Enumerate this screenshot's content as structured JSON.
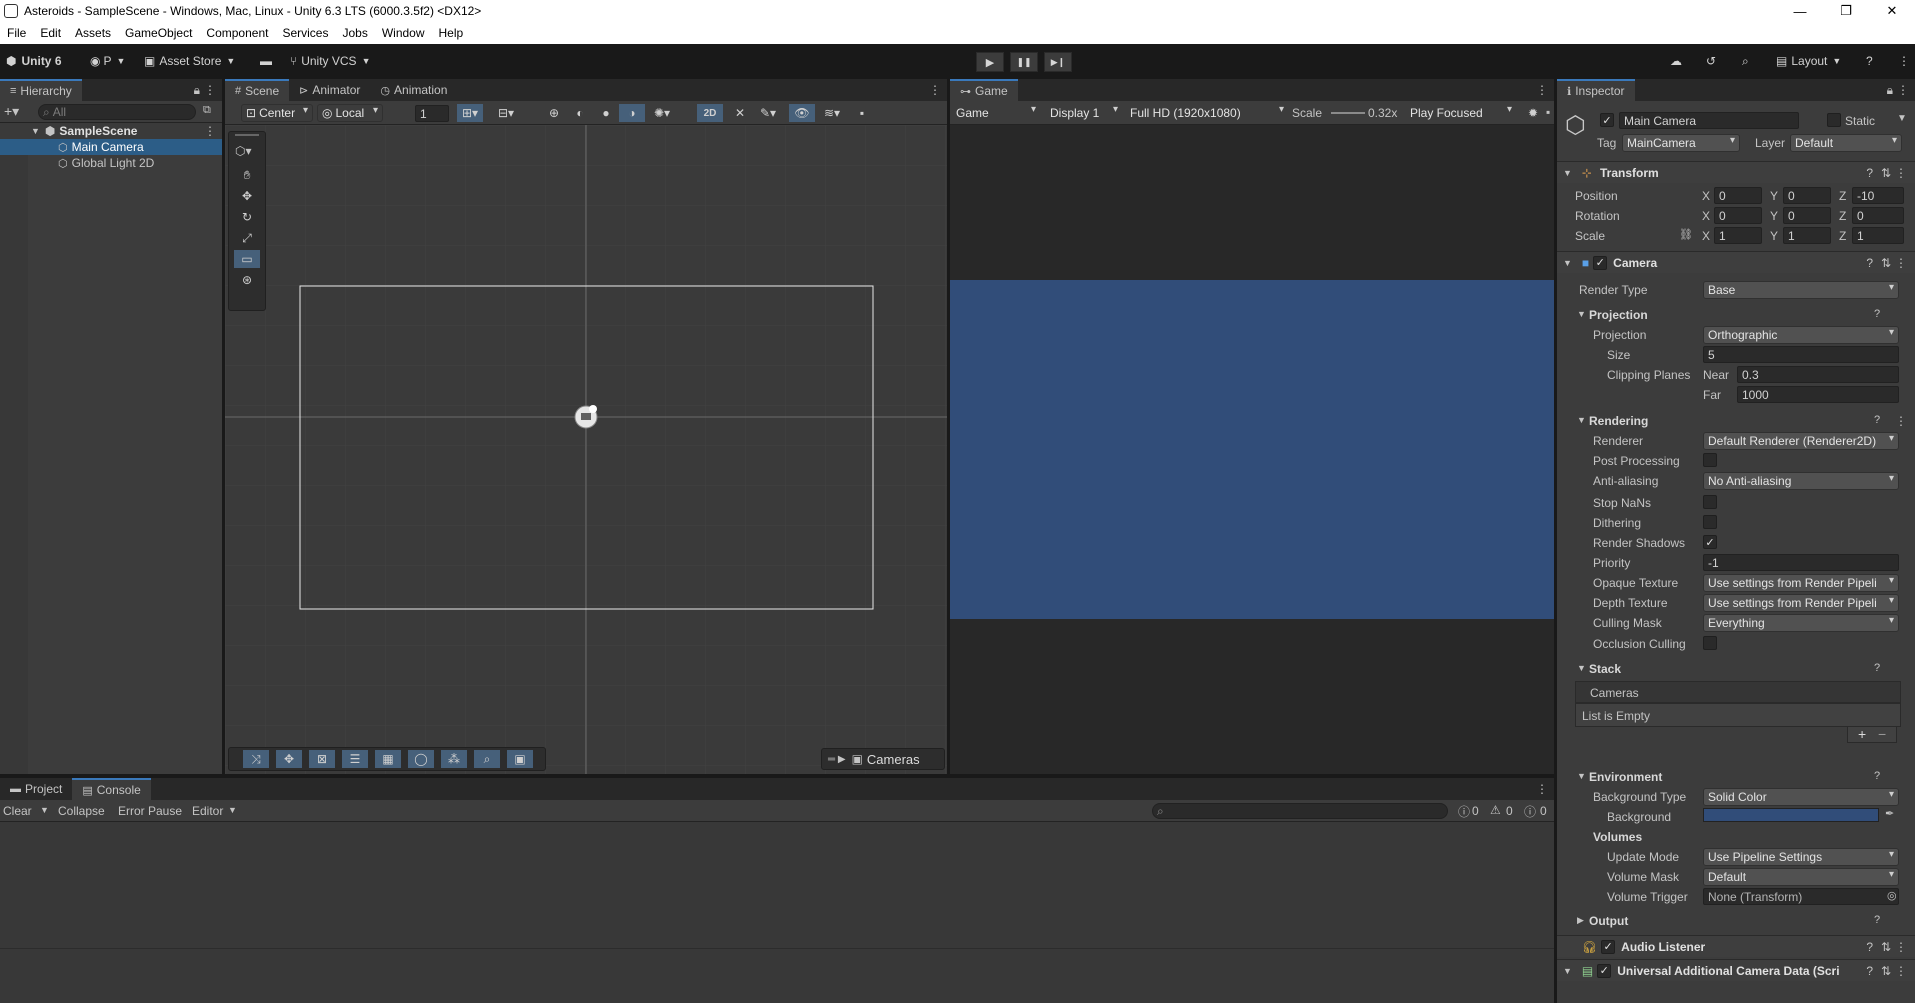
{
  "window": {
    "title": "Asteroids - SampleScene - Windows, Mac, Linux - Unity 6.3 LTS (6000.3.5f2) <DX12>",
    "minimize": "—",
    "maximize": "❐",
    "close": "✕"
  },
  "menu": [
    "File",
    "Edit",
    "Assets",
    "GameObject",
    "Component",
    "Services",
    "Jobs",
    "Window",
    "Help"
  ],
  "toolbar": {
    "unity_label": "Unity 6",
    "account_label": "P",
    "asset_store_label": "Asset Store",
    "vcs_label": "Unity VCS",
    "play": "▶",
    "pause": "❚❚",
    "step": "▶❙",
    "layout_label": "Layout",
    "help": "?"
  },
  "hierarchy": {
    "tab_label": "Hierarchy",
    "search_placeholder": "All",
    "scene_name": "SampleScene",
    "items": [
      {
        "label": "Main Camera"
      },
      {
        "label": "Global Light 2D"
      }
    ]
  },
  "scene_view": {
    "tabs": [
      {
        "label": "Scene",
        "icon": "#"
      },
      {
        "label": "Animator",
        "icon": "⊳"
      },
      {
        "label": "Animation",
        "icon": "◷"
      }
    ],
    "pivot_label": "Center",
    "space_label": "Local",
    "snap_value": "1",
    "mode_2d": "2D",
    "cameras_label": "Cameras"
  },
  "game_view": {
    "tab_label": "Game",
    "mode_label": "Game",
    "display_label": "Display 1",
    "resolution_label": "Full HD (1920x1080)",
    "scale_label": "Scale",
    "scale_value": "0.32x",
    "play_focus_label": "Play Focused",
    "background_color": "#314d79"
  },
  "inspector": {
    "tab_label": "Inspector",
    "object_name": "Main Camera",
    "static_label": "Static",
    "tag_label": "Tag",
    "tag_value": "MainCamera",
    "layer_label": "Layer",
    "layer_value": "Default",
    "transform": {
      "title": "Transform",
      "position_label": "Position",
      "rotation_label": "Rotation",
      "scale_label": "Scale",
      "x": "X",
      "y": "Y",
      "z": "Z",
      "position": [
        "0",
        "0",
        "-10"
      ],
      "rotation": [
        "0",
        "0",
        "0"
      ],
      "scale": [
        "1",
        "1",
        "1"
      ]
    },
    "camera": {
      "title": "Camera",
      "render_type_label": "Render Type",
      "render_type_value": "Base",
      "projection_header": "Projection",
      "projection_label": "Projection",
      "projection_value": "Orthographic",
      "size_label": "Size",
      "size_value": "5",
      "clipping_label": "Clipping Planes",
      "near_label": "Near",
      "near_value": "0.3",
      "far_label": "Far",
      "far_value": "1000",
      "rendering_header": "Rendering",
      "renderer_label": "Renderer",
      "renderer_value": "Default Renderer (Renderer2D)",
      "post_processing_label": "Post Processing",
      "anti_aliasing_label": "Anti-aliasing",
      "anti_aliasing_value": "No Anti-aliasing",
      "stop_nans_label": "Stop NaNs",
      "dithering_label": "Dithering",
      "render_shadows_label": "Render Shadows",
      "priority_label": "Priority",
      "priority_value": "-1",
      "opaque_texture_label": "Opaque Texture",
      "opaque_texture_value": "Use settings from Render Pipeli",
      "depth_texture_label": "Depth Texture",
      "depth_texture_value": "Use settings from Render Pipeli",
      "culling_mask_label": "Culling Mask",
      "culling_mask_value": "Everything",
      "occlusion_culling_label": "Occlusion Culling",
      "stack_header": "Stack",
      "cameras_label": "Cameras",
      "list_empty_label": "List is Empty",
      "add": "+",
      "remove": "−",
      "environment_header": "Environment",
      "background_type_label": "Background Type",
      "background_type_value": "Solid Color",
      "background_label": "Background",
      "background_color": "#314d79",
      "volumes_header": "Volumes",
      "update_mode_label": "Update Mode",
      "update_mode_value": "Use Pipeline Settings",
      "volume_mask_label": "Volume Mask",
      "volume_mask_value": "Default",
      "volume_trigger_label": "Volume Trigger",
      "volume_trigger_value": "None (Transform)",
      "output_header": "Output"
    },
    "audio_listener_title": "Audio Listener",
    "uacd_title": "Universal Additional Camera Data (Scri"
  },
  "console": {
    "tabs": [
      {
        "label": "Project"
      },
      {
        "label": "Console"
      }
    ],
    "clear_label": "Clear",
    "collapse_label": "Collapse",
    "error_pause_label": "Error Pause",
    "editor_label": "Editor",
    "log_count": "0",
    "warn_count": "0",
    "error_count": "0"
  },
  "accent_color": "#3a79bb"
}
